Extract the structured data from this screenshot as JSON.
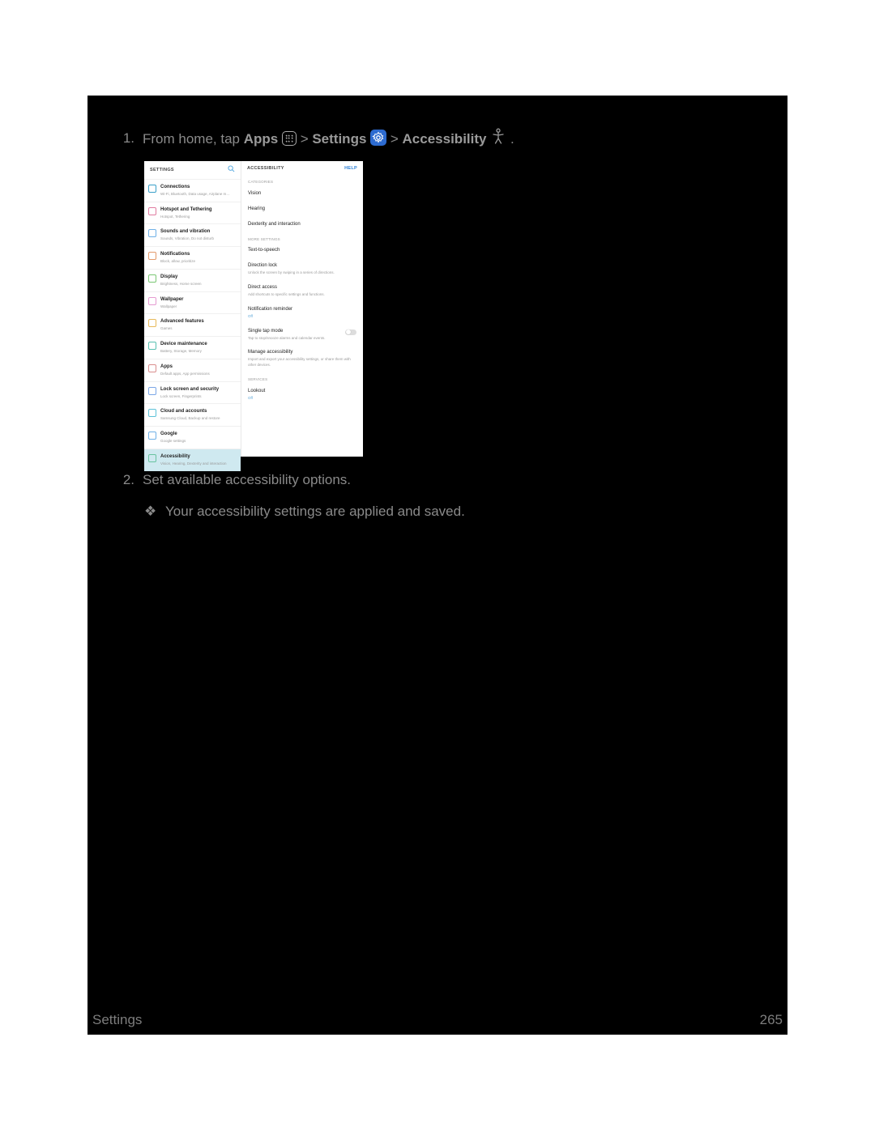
{
  "step1": {
    "number": "1.",
    "prefix": "From home, tap ",
    "apps": "Apps",
    "sep1": " > ",
    "settings": "Settings",
    "sep2": " > ",
    "accessibility": "Accessibility",
    "suffix": "."
  },
  "screenshot": {
    "left_header": "SETTINGS",
    "right_header": "ACCESSIBILITY",
    "help": "HELP",
    "categories_label": "CATEGORIES",
    "more_settings_label": "MORE SETTINGS",
    "services_label": "SERVICES",
    "left_items": [
      {
        "title": "Connections",
        "desc": "Wi-Fi, Bluetooth, Data usage, Airplane m…",
        "color": "#3aa0c9"
      },
      {
        "title": "Hotspot and Tethering",
        "desc": "Hotspot, Tethering",
        "color": "#e07ba0"
      },
      {
        "title": "Sounds and vibration",
        "desc": "Sounds, Vibration, Do not disturb",
        "color": "#6fb0e6"
      },
      {
        "title": "Notifications",
        "desc": "Block, allow, prioritize",
        "color": "#e39a6b"
      },
      {
        "title": "Display",
        "desc": "Brightness, Home screen",
        "color": "#7ac774"
      },
      {
        "title": "Wallpaper",
        "desc": "Wallpaper",
        "color": "#e59ad1"
      },
      {
        "title": "Advanced features",
        "desc": "Games",
        "color": "#e7b95a"
      },
      {
        "title": "Device maintenance",
        "desc": "Battery, Storage, Memory",
        "color": "#58c0b0"
      },
      {
        "title": "Apps",
        "desc": "Default apps, App permissions",
        "color": "#d98e8e"
      },
      {
        "title": "Lock screen and security",
        "desc": "Lock screen, Fingerprints",
        "color": "#7aa6e6"
      },
      {
        "title": "Cloud and accounts",
        "desc": "Samsung Cloud, Backup and restore",
        "color": "#5ec2d8"
      },
      {
        "title": "Google",
        "desc": "Google settings",
        "color": "#6fb0e6"
      },
      {
        "title": "Accessibility",
        "desc": "Vision, Hearing, Dexterity and interaction",
        "color": "#69c3a0",
        "selected": true
      }
    ],
    "right_categories": [
      {
        "title": "Vision"
      },
      {
        "title": "Hearing"
      },
      {
        "title": "Dexterity and interaction"
      }
    ],
    "right_more": [
      {
        "title": "Text-to-speech"
      },
      {
        "title": "Direction lock",
        "desc": "Unlock the screen by swiping in a series of directions."
      },
      {
        "title": "Direct access",
        "desc": "Add shortcuts to specific settings and functions."
      },
      {
        "title": "Notification reminder",
        "off": "Off"
      },
      {
        "title": "Single tap mode",
        "desc": "Tap to stop/snooze alarms and calendar events.",
        "toggle": true
      },
      {
        "title": "Manage accessibility",
        "desc": "Import and export your accessibility settings, or share them with other devices."
      }
    ],
    "right_services": [
      {
        "title": "Lookout",
        "off": "Off"
      }
    ]
  },
  "step2": {
    "number": "2.",
    "text": "Set available accessibility options."
  },
  "result": {
    "bullet": "❖",
    "text": "Your accessibility settings are applied and saved."
  },
  "footer": {
    "left": "Settings",
    "right": "265"
  }
}
